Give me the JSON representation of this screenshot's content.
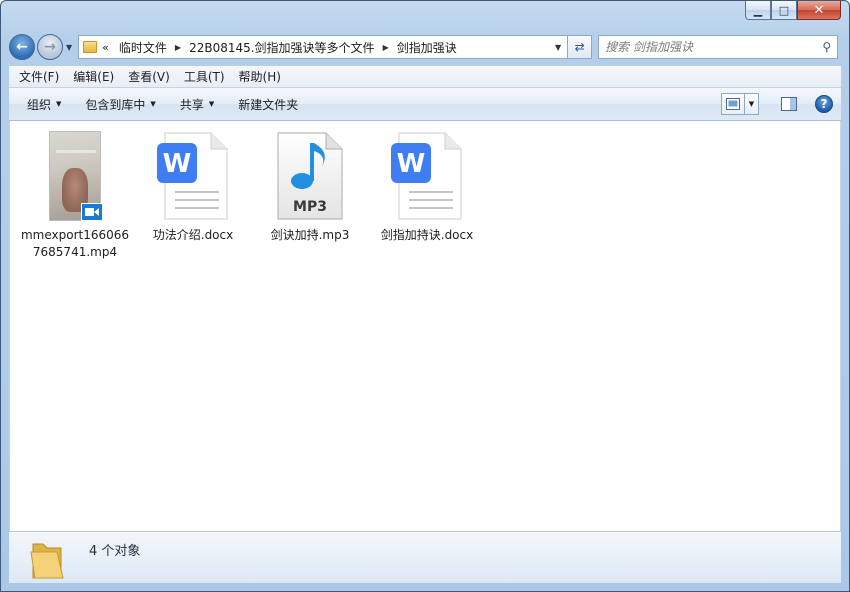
{
  "window": {
    "caption_min": "▁",
    "caption_max": "□",
    "caption_close": "✕"
  },
  "address": {
    "chevrons": "«",
    "segments": [
      "临时文件",
      "22B08145.剑指加强诀等多个文件",
      "剑指加强诀"
    ]
  },
  "search": {
    "placeholder": "搜索 剑指加强诀"
  },
  "menu": {
    "items": [
      "文件(F)",
      "编辑(E)",
      "查看(V)",
      "工具(T)",
      "帮助(H)"
    ]
  },
  "commands": {
    "organize": "组织",
    "include_in_library": "包含到库中",
    "share": "共享",
    "new_folder": "新建文件夹"
  },
  "files": [
    {
      "name": "mmexport1660667685741.mp4",
      "type": "video"
    },
    {
      "name": "功法介绍.docx",
      "type": "wps-doc"
    },
    {
      "name": "剑诀加持.mp3",
      "type": "mp3"
    },
    {
      "name": "剑指加持诀.docx",
      "type": "wps-doc"
    }
  ],
  "status": {
    "count_text": "4 个对象"
  },
  "colors": {
    "wps_blue": "#3e7df2",
    "mp3_blue": "#2190e0",
    "accent": "#1f5ca6"
  },
  "icons": {
    "mp3_badge": "MP3",
    "wps_letter": "W"
  }
}
